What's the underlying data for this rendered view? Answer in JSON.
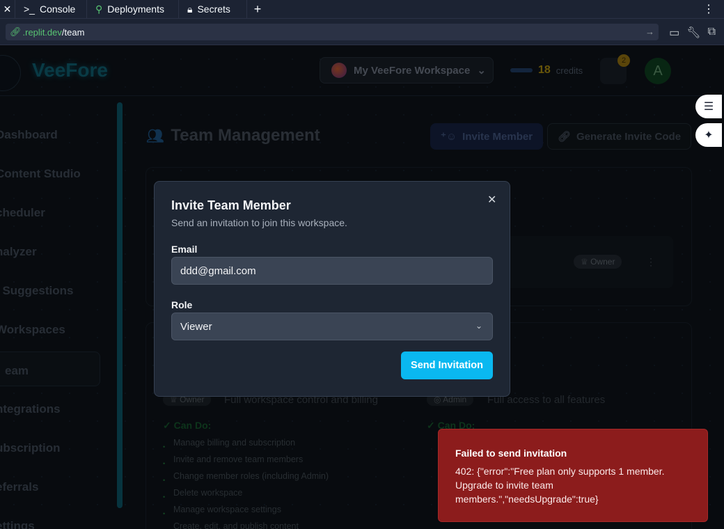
{
  "browser": {
    "tabs": [
      {
        "label": "Console",
        "icon": "terminal-icon"
      },
      {
        "label": "Deployments",
        "icon": "deploy-icon"
      },
      {
        "label": "Secrets",
        "icon": "lock-icon"
      }
    ],
    "url_domain": ".replit.dev",
    "url_path": "/team"
  },
  "app": {
    "logo": "VeeFore",
    "workspace": "My VeeFore Workspace",
    "credits_value": "18",
    "credits_label": "credits",
    "notification_count": "2",
    "avatar_initial": "A",
    "sidebar": [
      "Dashboard",
      "Content Studio",
      "Scheduler",
      "Analyzer",
      "AI Suggestions",
      "Workspaces",
      "Team",
      "Integrations",
      "Subscription",
      "Referrals",
      "Settings"
    ],
    "sidebar_visible": [
      "Dashboard",
      "Content Studio",
      "cheduler",
      "nalyzer",
      "I Suggestions",
      "Workspaces",
      "eam",
      "ntegrations",
      "ubscription",
      "eferrals",
      "ettings"
    ],
    "active_item": "Team",
    "page_title": "Team Management",
    "invite_button": "Invite Member",
    "generate_button": "Generate Invite Code",
    "owner_badge": "Owner",
    "roles": [
      {
        "name": "Owner",
        "desc": "Full workspace control and billing"
      },
      {
        "name": "Admin",
        "desc": "Full access to all features"
      }
    ],
    "can_do_label": "✓ Can Do:",
    "owner_permissions": [
      "Manage billing and subscription",
      "Invite and remove team members",
      "Change member roles (including Admin)",
      "Delete workspace",
      "Manage workspace settings",
      "Create, edit, and publish content"
    ]
  },
  "modal": {
    "title": "Invite Team Member",
    "subtitle": "Send an invitation to join this workspace.",
    "email_label": "Email",
    "email_value": "ddd@gmail.com",
    "role_label": "Role",
    "role_value": "Viewer",
    "send_label": "Send Invitation"
  },
  "toast": {
    "title": "Failed to send invitation",
    "body": "402: {\"error\":\"Free plan only supports 1 member. Upgrade to invite team members.\",\"needsUpgrade\":true}"
  },
  "colors": {
    "accent": "#0ab8f0",
    "error": "#8c1c1c",
    "modal_bg": "#1e2633"
  }
}
